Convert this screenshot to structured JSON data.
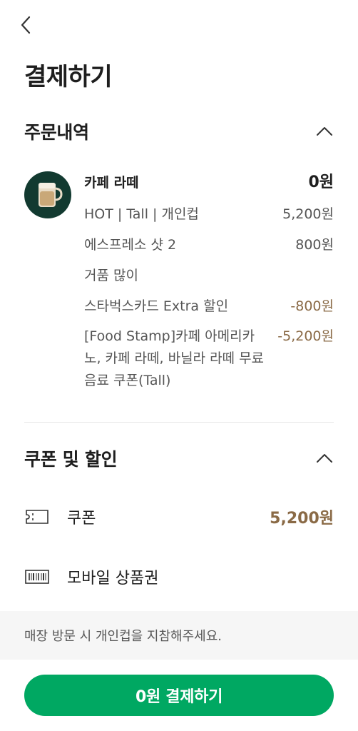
{
  "header": {
    "title": "결제하기"
  },
  "order": {
    "section_title": "주문내역",
    "product": {
      "name": "카페 라떼",
      "price": "0원",
      "thumb_icon": "latte-mug-icon"
    },
    "rows": [
      {
        "label": "HOT | Tall | 개인컵",
        "price": "5,200원"
      },
      {
        "label": "에스프레소 샷 2",
        "price": "800원"
      },
      {
        "label": "거품 많이",
        "price": ""
      },
      {
        "label": "스타벅스카드 Extra 할인",
        "price": "-800원"
      },
      {
        "label": "[Food Stamp]카페 아메리카노, 카페 라떼, 바닐라 라떼 무료 음료 쿠폰(Tall)",
        "price": "-5,200원"
      }
    ]
  },
  "discounts": {
    "section_title": "쿠폰 및 할인",
    "coupon": {
      "label": "쿠폰",
      "value": "5,200원",
      "icon": "ticket-icon"
    },
    "gift": {
      "label": "모바일 상품권",
      "icon": "barcode-icon"
    }
  },
  "notice": {
    "text": "매장 방문 시 개인컵을 지참해주세요."
  },
  "pay_button": {
    "label": "0원 결제하기"
  },
  "colors": {
    "brand_green": "#00a862",
    "discount_brown": "#8a6a46",
    "thumb_bg": "#123a30"
  }
}
